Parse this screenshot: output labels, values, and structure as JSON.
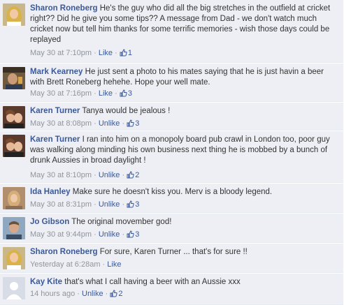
{
  "comments": [
    {
      "author": "Sharon Roneberg",
      "text": "He's the guy who did all the big stretches in the outfield at cricket right?? Did he give you some tips?? A message from Dad - we don't watch much cricket now but tell him thanks for some terrific memories - wish those days could be replayed",
      "time": "May 30 at 7:10pm",
      "action": "Like",
      "likes": "1",
      "avatar": "sharon"
    },
    {
      "author": "Mark Kearney",
      "text": "He just sent a photo to his mates saying that he is just havin a beer with Brett Roneberg hehehe. Hope your well mate.",
      "time": "May 30 at 7:16pm",
      "action": "Like",
      "likes": "3",
      "avatar": "mark"
    },
    {
      "author": "Karen Turner",
      "text": "Tanya would be jealous !",
      "time": "May 30 at 8:08pm",
      "action": "Unlike",
      "likes": "3",
      "avatar": "karen"
    },
    {
      "author": "Karen Turner",
      "text": "I ran into him on a monopoly board pub crawl in London too, poor guy was walking along minding his own business next thing he is mobbed by a bunch of drunk Aussies in broad daylight !",
      "time": "May 30 at 8:10pm",
      "action": "Unlike",
      "likes": "2",
      "avatar": "karen"
    },
    {
      "author": "Ida Hanley",
      "text": "Make sure he doesn't kiss you. Merv is a bloody legend.",
      "time": "May 30 at 8:31pm",
      "action": "Unlike",
      "likes": "3",
      "avatar": "ida"
    },
    {
      "author": "Jo Gibson",
      "text": "The original movember god!",
      "time": "May 30 at 9:44pm",
      "action": "Unlike",
      "likes": "3",
      "avatar": "jo"
    },
    {
      "author": "Sharon Roneberg",
      "text": "For sure, Karen Turner ... that's for sure !!",
      "time": "Yesterday at 6:28am",
      "action": "Like",
      "likes": "",
      "avatar": "sharon"
    },
    {
      "author": "Kay Kite",
      "text": "that's what I call having a beer with an Aussie xxx",
      "time": "14 hours ago",
      "action": "Unlike",
      "likes": "2",
      "avatar": "kay"
    }
  ],
  "colors": {
    "link": "#3b5998",
    "meta": "#90949c",
    "background": "#edeff4"
  }
}
